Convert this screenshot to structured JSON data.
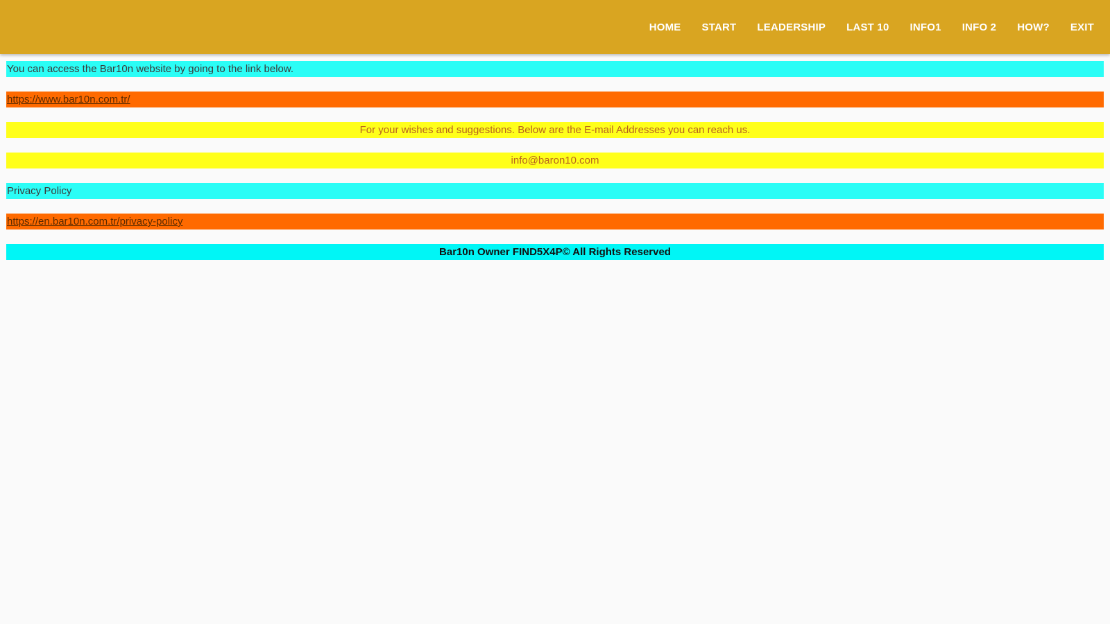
{
  "nav": {
    "items": [
      "HOME",
      "START",
      "LEADERSHIP",
      "LAST 10",
      "INFO1",
      "INFO 2",
      "HOW?",
      "EXIT"
    ]
  },
  "content": {
    "access_text": "You can access the Bar10n website by going to the link below.",
    "website_link": "https://www.bar10n.com.tr/",
    "suggestions_text": "For your wishes and suggestions. Below are the E-mail Addresses you can reach us.",
    "email": "info@baron10.com",
    "privacy_label": "Privacy Policy",
    "privacy_link": "https://en.bar10n.com.tr/privacy-policy",
    "footer": "Bar10n Owner FIND5X4P© All Rights Reserved"
  },
  "colors": {
    "header": "#d9a521",
    "cyan": "#2bfdf6",
    "orange": "#ff6a00",
    "yellow": "#ffff1a",
    "footer_cyan": "#00f6f6"
  }
}
